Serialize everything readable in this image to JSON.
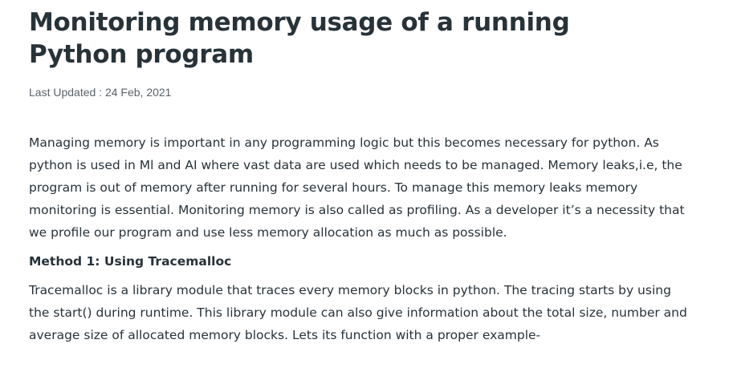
{
  "article": {
    "title": "Monitoring memory usage of a running Python program",
    "last_updated_label": "Last Updated : ",
    "last_updated_date": "24 Feb, 2021",
    "paragraphs": [
      "Managing memory is important in any programming logic but this becomes necessary for python. As python is used in Ml and AI where vast data are used which needs to be managed. Memory leaks,i.e, the program is out of memory after running for several hours. To manage this memory leaks memory monitoring is essential. Monitoring memory is also called as profiling. As a developer it’s a necessity that we profile our program and use less memory allocation as much as possible."
    ],
    "method_heading": "Method 1: Using Tracemalloc",
    "method_paragraph": "Tracemalloc is a library module that traces every memory blocks in python. The tracing starts by using the start() during runtime. This library module can also give information about the total size, number and average size of allocated memory blocks. Lets its function with a proper example-"
  }
}
